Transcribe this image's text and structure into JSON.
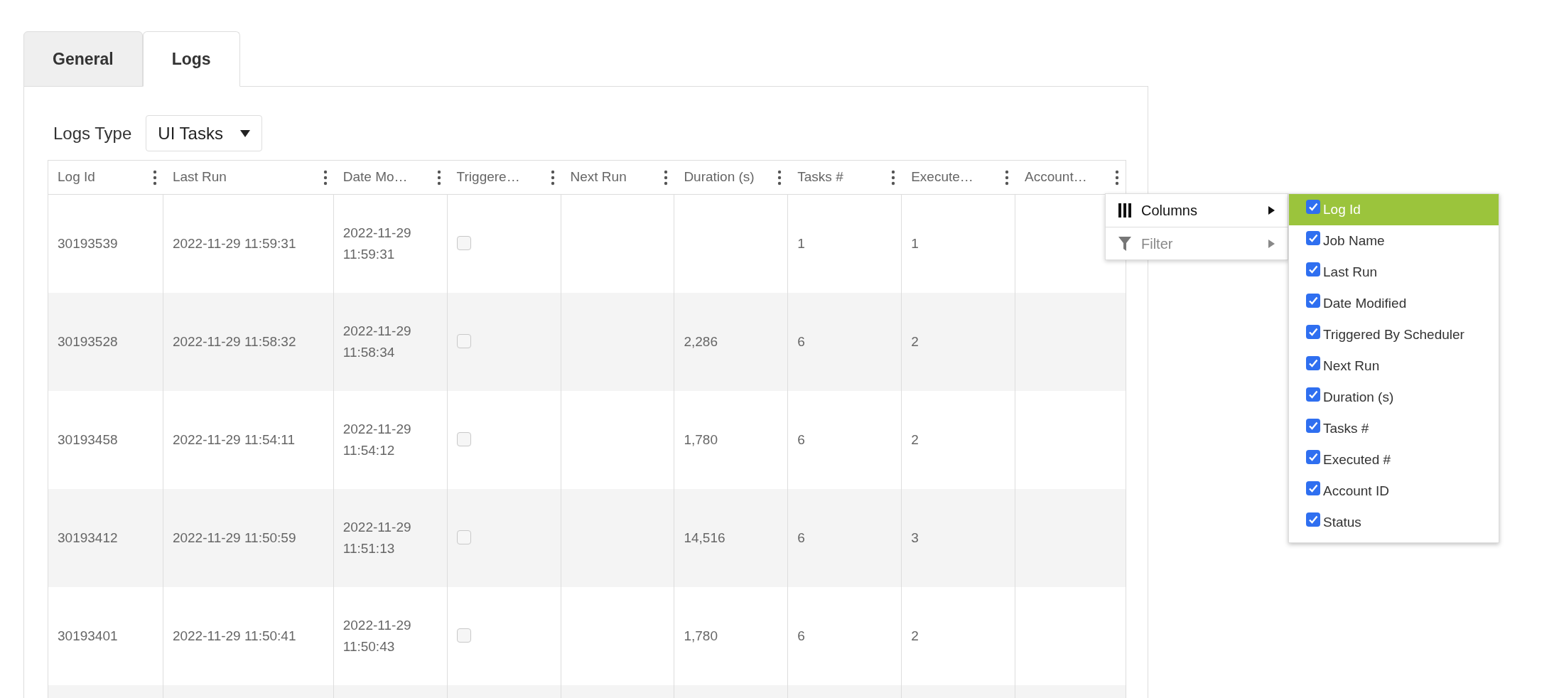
{
  "tabs": [
    {
      "label": "General",
      "selected": false
    },
    {
      "label": "Logs",
      "selected": true
    }
  ],
  "logs_type": {
    "label": "Logs Type",
    "value": "UI Tasks"
  },
  "table": {
    "columns": [
      "Log Id",
      "Last Run",
      "Date Mo…",
      "Triggere…",
      "Next Run",
      "Duration (s)",
      "Tasks #",
      "Execute…",
      "Account…"
    ],
    "rows": [
      {
        "log_id": "30193539",
        "last_run": "2022-11-29 11:59:31",
        "date_modified": [
          "2022-11-29",
          "11:59:31"
        ],
        "triggered": false,
        "next_run": "",
        "duration": "",
        "tasks": "1",
        "executed": "1"
      },
      {
        "log_id": "30193528",
        "last_run": "2022-11-29 11:58:32",
        "date_modified": [
          "2022-11-29",
          "11:58:34"
        ],
        "triggered": false,
        "next_run": "",
        "duration": "2,286",
        "tasks": "6",
        "executed": "2"
      },
      {
        "log_id": "30193458",
        "last_run": "2022-11-29 11:54:11",
        "date_modified": [
          "2022-11-29",
          "11:54:12"
        ],
        "triggered": false,
        "next_run": "",
        "duration": "1,780",
        "tasks": "6",
        "executed": "2"
      },
      {
        "log_id": "30193412",
        "last_run": "2022-11-29 11:50:59",
        "date_modified": [
          "2022-11-29",
          "11:51:13"
        ],
        "triggered": false,
        "next_run": "",
        "duration": "14,516",
        "tasks": "6",
        "executed": "3"
      },
      {
        "log_id": "30193401",
        "last_run": "2022-11-29 11:50:41",
        "date_modified": [
          "2022-11-29",
          "11:50:43"
        ],
        "triggered": false,
        "next_run": "",
        "duration": "1,780",
        "tasks": "6",
        "executed": "2"
      }
    ]
  },
  "column_menu": {
    "items": [
      {
        "label": "Columns",
        "kind": "columns",
        "disabled": false
      },
      {
        "label": "Filter",
        "kind": "filter",
        "disabled": true
      }
    ],
    "submenu": [
      {
        "label": "Log Id",
        "checked": true,
        "selected": true
      },
      {
        "label": "Job Name",
        "checked": true,
        "selected": false
      },
      {
        "label": "Last Run",
        "checked": true,
        "selected": false
      },
      {
        "label": "Date Modified",
        "checked": true,
        "selected": false
      },
      {
        "label": "Triggered By Scheduler",
        "checked": true,
        "selected": false
      },
      {
        "label": "Next Run",
        "checked": true,
        "selected": false
      },
      {
        "label": "Duration (s)",
        "checked": true,
        "selected": false
      },
      {
        "label": "Tasks #",
        "checked": true,
        "selected": false
      },
      {
        "label": "Executed #",
        "checked": true,
        "selected": false
      },
      {
        "label": "Account ID",
        "checked": true,
        "selected": false
      },
      {
        "label": "Status",
        "checked": true,
        "selected": false
      }
    ]
  }
}
